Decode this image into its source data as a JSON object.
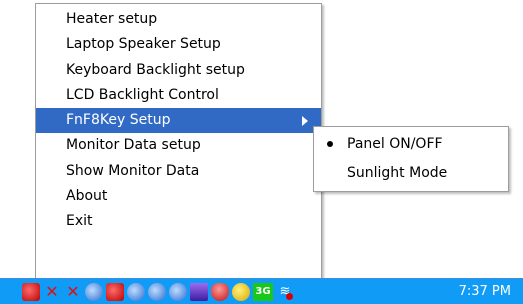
{
  "main_menu": {
    "items": [
      {
        "label": "Heater setup"
      },
      {
        "label": "Laptop Speaker Setup"
      },
      {
        "label": "Keyboard Backlight setup"
      },
      {
        "label": "LCD Backlight Control"
      },
      {
        "label": "FnF8Key Setup"
      },
      {
        "label": "Monitor Data setup"
      },
      {
        "label": "Show Monitor Data"
      },
      {
        "label": "About"
      },
      {
        "label": "Exit"
      }
    ],
    "selected_index": 4,
    "highlight_color": "#316ac5"
  },
  "sub_menu": {
    "items": [
      {
        "label": "Panel ON/OFF",
        "checked": true
      },
      {
        "label": "Sunlight Mode",
        "checked": false
      }
    ]
  },
  "taskbar": {
    "color": "#0f9bf6",
    "tray_icons": [
      "app-icon",
      "network-error-icon",
      "network-error-icon",
      "volume-icon",
      "speaker-icon",
      "sync-icon",
      "display-icon",
      "security-icon",
      "monitor-app-icon",
      "shield-icon",
      "messenger-icon",
      "3g-icon",
      "wifi-icon"
    ],
    "badge_3g": "3G",
    "clock": "7:37 PM"
  }
}
